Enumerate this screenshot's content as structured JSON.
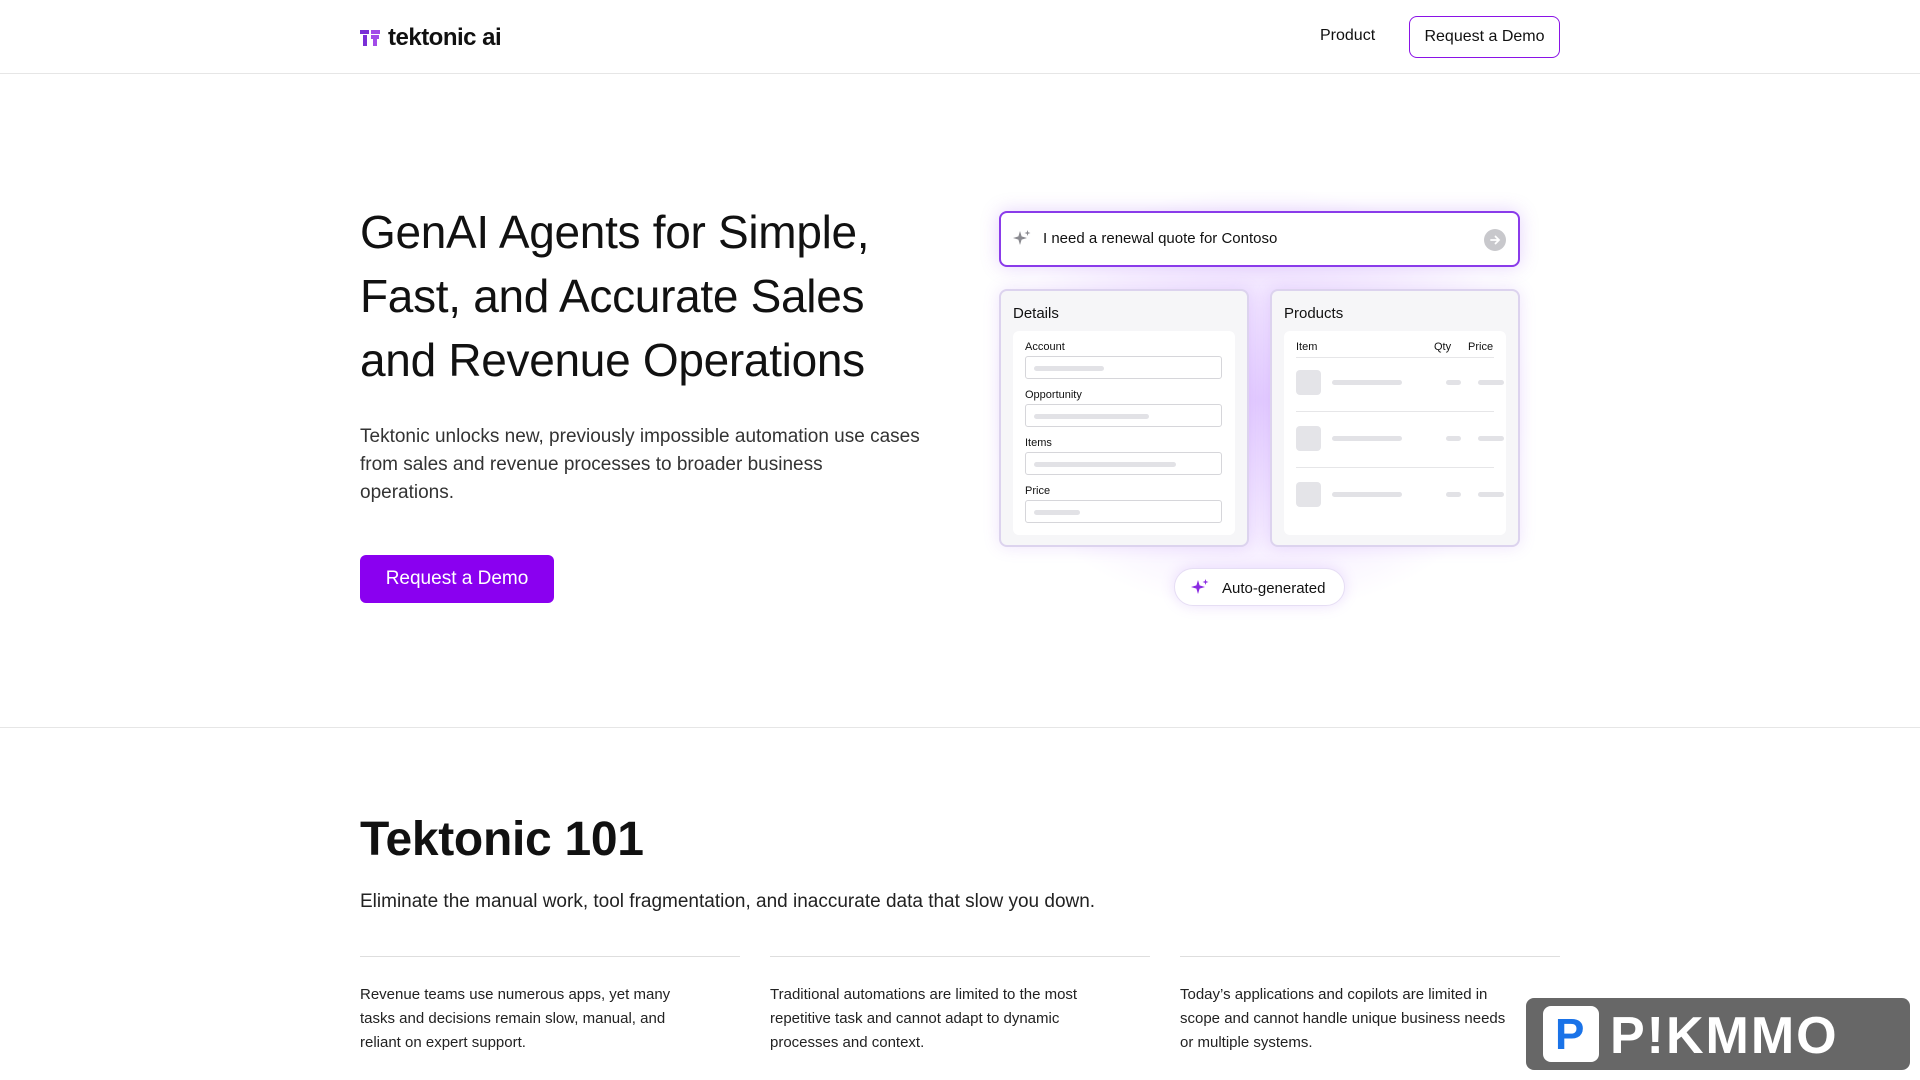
{
  "header": {
    "logo_text": "tektonic ai",
    "nav": {
      "product_label": "Product",
      "demo_label": "Request a Demo"
    }
  },
  "hero": {
    "title": "GenAI Agents for Simple, Fast, and Accurate Sales and Revenue Operations",
    "subtitle": "Tektonic unlocks new, previously impossible automation use cases from sales and revenue processes to broader business operations.",
    "cta_label": "Request a Demo"
  },
  "illustration": {
    "prompt_text": "I need a renewal quote for Contoso",
    "details": {
      "title": "Details",
      "fields": [
        "Account",
        "Opportunity",
        "Items",
        "Price"
      ]
    },
    "products": {
      "title": "Products",
      "columns": {
        "item": "Item",
        "qty": "Qty",
        "price": "Price"
      }
    },
    "auto_label": "Auto-generated"
  },
  "section_101": {
    "title": "Tektonic 101",
    "subtitle": "Eliminate the manual work, tool fragmentation, and inaccurate data that slow you down.",
    "columns": [
      {
        "text": "Revenue teams use numerous apps, yet many tasks and decisions remain slow, manual, and reliant on expert support."
      },
      {
        "text": "Traditional automations are limited to the most repetitive task and cannot adapt to dynamic processes and context."
      },
      {
        "text": "Today’s applications and copilots are limited in scope and cannot handle unique business needs or multiple systems."
      }
    ]
  },
  "watermark": {
    "letter": "P",
    "text": "P!KMMO"
  },
  "colors": {
    "accent": "#8a00f0",
    "accent_border": "#8a3bea"
  }
}
